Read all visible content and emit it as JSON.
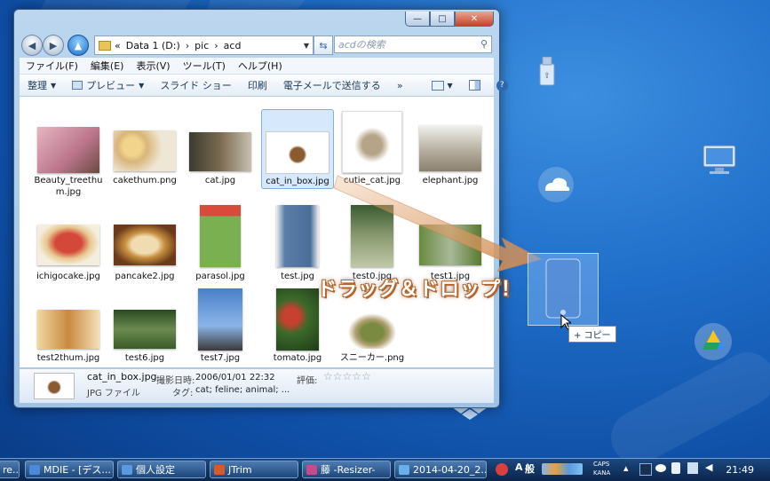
{
  "window": {
    "address_parts": [
      "«",
      "Data 1 (D:)",
      "›",
      "pic",
      "›",
      "acd"
    ],
    "search_placeholder": "acdの検索",
    "caption": {
      "min": "—",
      "max": "□",
      "close": "✕"
    }
  },
  "menu": [
    "ファイル(F)",
    "編集(E)",
    "表示(V)",
    "ツール(T)",
    "ヘルプ(H)"
  ],
  "toolbar": {
    "organize": "整理",
    "preview": "プレビュー",
    "slideshow": "スライド ショー",
    "print": "印刷",
    "email": "電子メールで送信する",
    "more": "»"
  },
  "files": [
    {
      "name": "Beauty_treethu m.jpg",
      "icon": "cherry-blossom-image",
      "color": "#c98a9a"
    },
    {
      "name": "cakethum.png",
      "icon": "cake-image",
      "color": "#d9b67a"
    },
    {
      "name": "cat.jpg",
      "icon": "cat-image",
      "color": "#6b5a40"
    },
    {
      "name": "cat_in_box.jpg",
      "icon": "cat-in-box-image",
      "color": "#8a5a30",
      "selected": true
    },
    {
      "name": "cutie_cat.jpg",
      "icon": "cat-image",
      "color": "#c8b8a0"
    },
    {
      "name": "elephant.jpg",
      "icon": "elephant-image",
      "color": "#9a9080"
    },
    {
      "name": "ichigocake.jpg",
      "icon": "strawberry-cake-image",
      "color": "#c0403a"
    },
    {
      "name": "pancake2.jpg",
      "icon": "pancake-image",
      "color": "#c89040"
    },
    {
      "name": "parasol.jpg",
      "icon": "parasol-image",
      "color": "#5aa040"
    },
    {
      "name": "test.jpg",
      "icon": "jeans-image",
      "color": "#5a7ea8"
    },
    {
      "name": "test0.jpg",
      "icon": "cat-image",
      "color": "#5a7a40"
    },
    {
      "name": "test1.jpg",
      "icon": "cat-image",
      "color": "#7a9a50"
    },
    {
      "name": "test2thum.jpg",
      "icon": "cat-image",
      "color": "#c89050"
    },
    {
      "name": "test6.jpg",
      "icon": "cat-image",
      "color": "#4a6a3a"
    },
    {
      "name": "test7.jpg",
      "icon": "clock-tower-image",
      "color": "#5080c0"
    },
    {
      "name": "tomato.jpg",
      "icon": "tomato-image",
      "color": "#b03a30"
    },
    {
      "name": "スニーカー.png",
      "icon": "sneaker-image",
      "color": "#6a7a40"
    }
  ],
  "details": {
    "filename": "cat_in_box.jpg",
    "filetype": "JPG ファイル",
    "date_label": "撮影日時:",
    "date": "2006/01/01 22:32",
    "tags_label": "タグ:",
    "tags": "cat; feline; animal; ...",
    "rating_label": "評価:",
    "rating": 0
  },
  "overlay": {
    "drag_text": "ドラッグ＆ドロップ！",
    "copy_tip": "+ コピー"
  },
  "taskbar": {
    "buttons": [
      {
        "label": "re...",
        "color": "#3a78c8"
      },
      {
        "label": "MDIE - [デス...",
        "color": "#4a8ad8"
      },
      {
        "label": "個人設定",
        "color": "#5a9ae0"
      },
      {
        "label": "JTrim",
        "color": "#d85a2a"
      },
      {
        "label": "藤 -Resizer-",
        "color": "#c84a8a"
      },
      {
        "label": "2014-04-20_2...",
        "color": "#6ab0e8"
      }
    ],
    "tray": [
      "A",
      "般",
      "CAPS",
      "KANA"
    ],
    "clock": "21:49"
  },
  "colors": {
    "accent": "#2f68ad",
    "arrow": "#d08a50",
    "desktop": "#1f6ec9"
  }
}
